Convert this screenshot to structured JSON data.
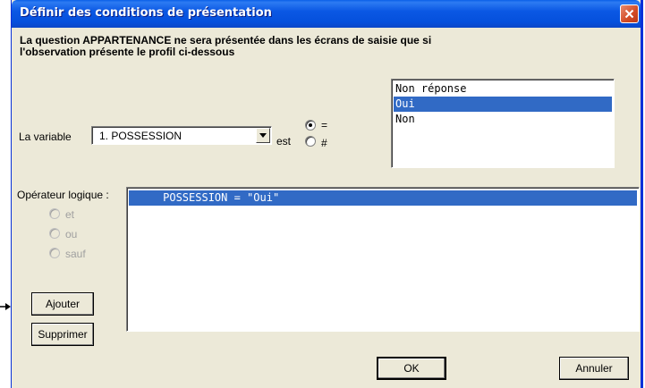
{
  "window": {
    "title": "Définir des conditions de présentation"
  },
  "heading": {
    "line1": "La question APPARTENANCE ne sera présentée dans les écrans de saisie que si",
    "line2": "l'observation présente le profil ci-dessous"
  },
  "variable": {
    "label": "La variable",
    "selected": "1. POSSESSION",
    "est_label": "est"
  },
  "comparison": {
    "options": [
      {
        "label": "=",
        "checked": true
      },
      {
        "label": "#",
        "checked": false
      }
    ]
  },
  "values_list": {
    "items": [
      {
        "label": "Non réponse",
        "selected": false
      },
      {
        "label": "Oui",
        "selected": true
      },
      {
        "label": "Non",
        "selected": false
      }
    ]
  },
  "operator": {
    "label": "Opérateur logique :",
    "options": [
      {
        "label": "et",
        "enabled": false
      },
      {
        "label": "ou",
        "enabled": false
      },
      {
        "label": "sauf",
        "enabled": false
      }
    ]
  },
  "conditions": {
    "items": [
      {
        "text": "     POSSESSION = \"Oui\"",
        "selected": true
      }
    ]
  },
  "buttons": {
    "add": "Ajouter",
    "remove": "Supprimer",
    "ok": "OK",
    "cancel": "Annuler"
  },
  "colors": {
    "title_bar": "#0550dc",
    "selection": "#316ac5",
    "dialog_bg": "#ece9d8",
    "close_button": "#d24a23"
  }
}
